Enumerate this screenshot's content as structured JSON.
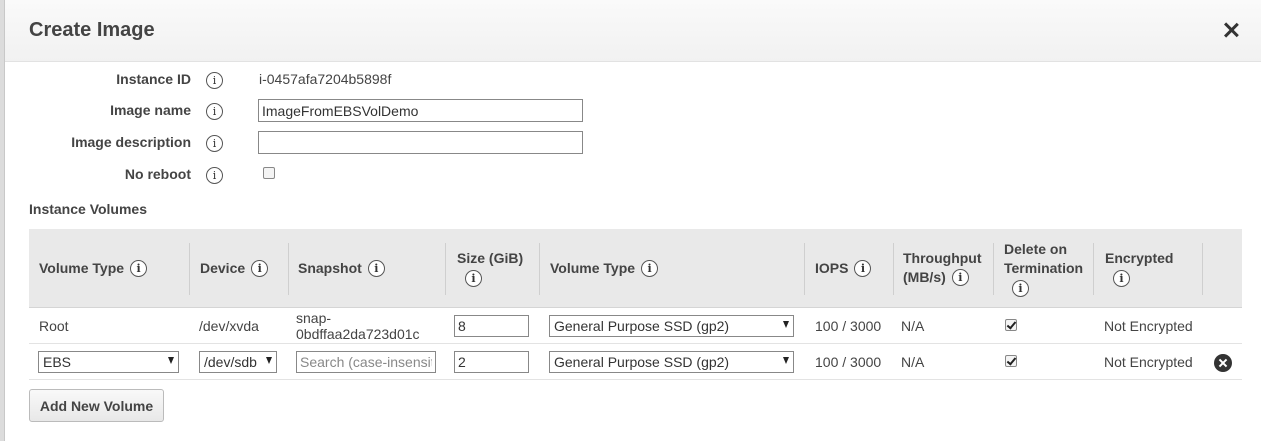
{
  "dialog": {
    "title": "Create Image"
  },
  "form": {
    "instance_id": {
      "label": "Instance ID",
      "value": "i-0457afa7204b5898f"
    },
    "image_name": {
      "label": "Image name",
      "value": "ImageFromEBSVolDemo"
    },
    "image_description": {
      "label": "Image description",
      "value": ""
    },
    "no_reboot": {
      "label": "No reboot",
      "checked": false
    }
  },
  "volumes": {
    "section_title": "Instance Volumes",
    "headers": {
      "volume_type": "Volume Type",
      "device": "Device",
      "snapshot": "Snapshot",
      "size": "Size (GiB)",
      "volume_type2": "Volume Type",
      "iops": "IOPS",
      "throughput_line1": "Throughput",
      "throughput_line2": "(MB/s)",
      "delete_line1": "Delete on",
      "delete_line2": "Termination",
      "encrypted": "Encrypted"
    },
    "rows": [
      {
        "volume_type": "Root",
        "device": "/dev/xvda",
        "snapshot_line1": "snap-",
        "snapshot_line2": "0bdffaa2da723d01c",
        "size": "8",
        "ebs_type": "General Purpose SSD (gp2)",
        "iops": "100 / 3000",
        "throughput": "N/A",
        "delete_on_termination": true,
        "encrypted": "Not Encrypted"
      },
      {
        "volume_type": "EBS",
        "device": "/dev/sdb",
        "snapshot_placeholder": "Search (case-insensit",
        "size": "2",
        "ebs_type": "General Purpose SSD (gp2)",
        "iops": "100 / 3000",
        "throughput": "N/A",
        "delete_on_termination": true,
        "encrypted": "Not Encrypted"
      }
    ],
    "add_button": "Add New Volume"
  },
  "icons": {
    "info": "i",
    "close": "close-icon",
    "remove": "remove-circle-icon"
  }
}
